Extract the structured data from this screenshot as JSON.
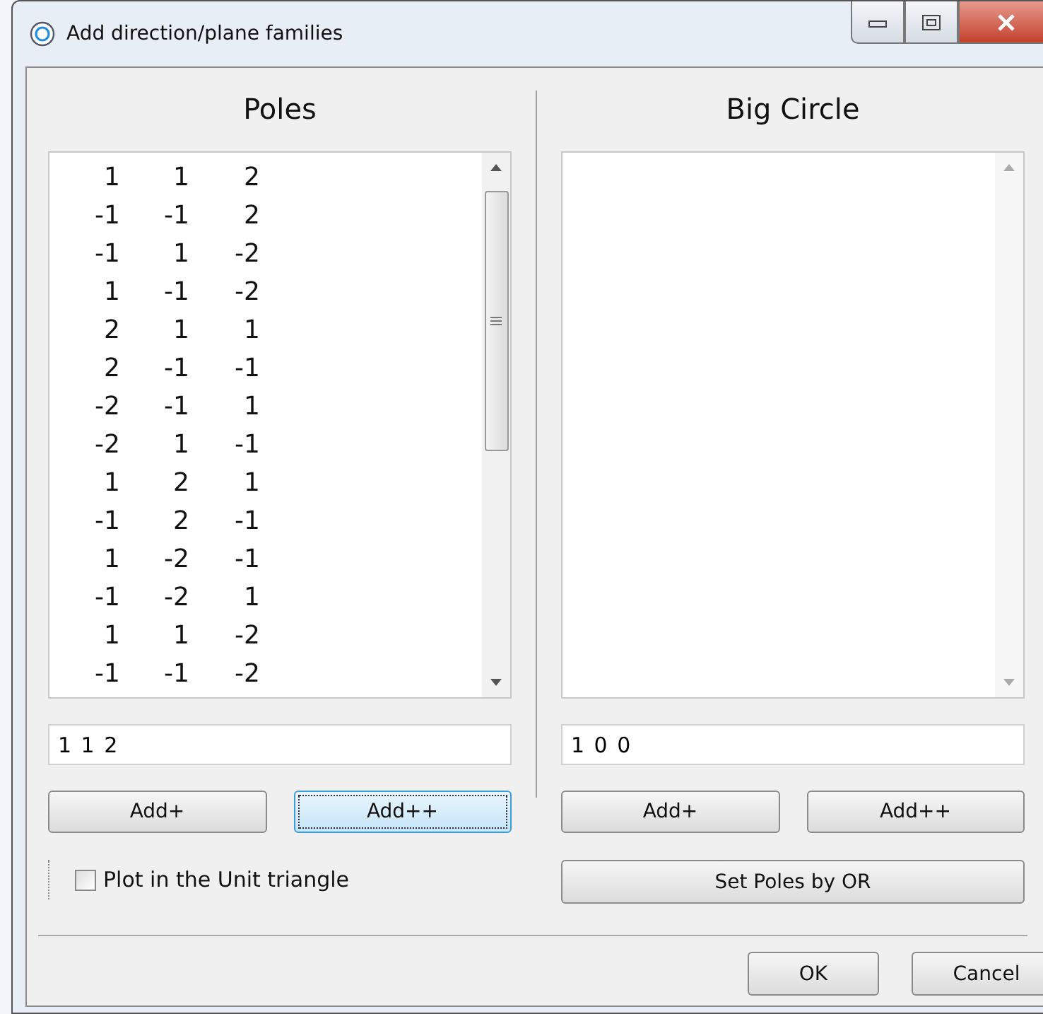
{
  "window": {
    "title": "Add direction/plane families"
  },
  "poles": {
    "title": "Poles",
    "rows": [
      [
        "1",
        "1",
        "2"
      ],
      [
        "-1",
        "-1",
        "2"
      ],
      [
        "-1",
        "1",
        "-2"
      ],
      [
        "1",
        "-1",
        "-2"
      ],
      [
        "2",
        "1",
        "1"
      ],
      [
        "2",
        "-1",
        "-1"
      ],
      [
        "-2",
        "-1",
        "1"
      ],
      [
        "-2",
        "1",
        "-1"
      ],
      [
        "1",
        "2",
        "1"
      ],
      [
        "-1",
        "2",
        "-1"
      ],
      [
        "1",
        "-2",
        "-1"
      ],
      [
        "-1",
        "-2",
        "1"
      ],
      [
        "1",
        "1",
        "-2"
      ],
      [
        "-1",
        "-1",
        "-2"
      ]
    ],
    "input": "1 1 2",
    "buttons": [
      {
        "label": "Add+",
        "focused": false
      },
      {
        "label": "Add++",
        "focused": true
      }
    ],
    "checkbox": {
      "label": "Plot in the Unit triangle",
      "checked": false
    }
  },
  "big_circle": {
    "title": "Big Circle",
    "input": "1 0 0",
    "buttons": [
      {
        "label": "Add+",
        "focused": false
      },
      {
        "label": "Add++",
        "focused": false
      }
    ],
    "set_button": "Set Poles by OR"
  },
  "footer_buttons": [
    "OK",
    "Cancel"
  ]
}
